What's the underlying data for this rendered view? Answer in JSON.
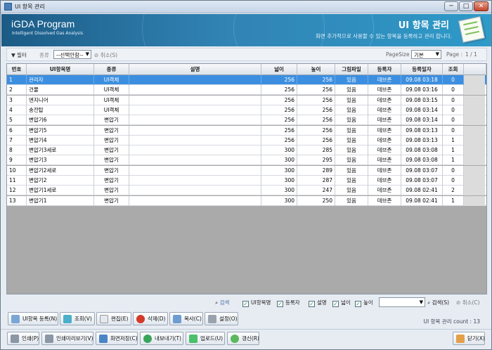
{
  "window": {
    "title": "UI 항목 관리",
    "minimize": "─",
    "maximize": "□",
    "close": "✕"
  },
  "banner": {
    "product": "iGDA Program",
    "subtitle": "Intelligent Dissolved Gas Analysis",
    "heading": "UI 항목 관리",
    "description": "화면 추가적으로 사용할 수 있는 항목을 등록하고 관리 합니다."
  },
  "toolbar": {
    "filter_label": "필터",
    "type_label": "종류",
    "type_value": "--선택안함--",
    "cancel_label": "취소(S)",
    "pagesize_label": "PageSize",
    "pagesize_value": "기본",
    "page_label": "Page :",
    "page_value": "1 / 1"
  },
  "table": {
    "columns": [
      "번호",
      "UI항목명",
      "종류",
      "설명",
      "넓이",
      "높이",
      "그림파일",
      "등록자",
      "등록일자",
      "조회"
    ],
    "rows": [
      [
        "1",
        "관리자",
        "UI객체",
        "",
        "256",
        "256",
        "있음",
        "데브존",
        "09.08 03:18",
        "0"
      ],
      [
        "2",
        "건물",
        "UI객체",
        "",
        "256",
        "256",
        "있음",
        "데브존",
        "09.08 03:16",
        "0"
      ],
      [
        "3",
        "엔지니어",
        "UI객체",
        "",
        "256",
        "256",
        "있음",
        "데브존",
        "09.08 03:15",
        "0"
      ],
      [
        "4",
        "송전탑",
        "UI객체",
        "",
        "256",
        "256",
        "있음",
        "데브존",
        "09.08 03:14",
        "0"
      ],
      [
        "5",
        "변압기6",
        "변압기",
        "",
        "256",
        "256",
        "있음",
        "데브존",
        "09.08 03:14",
        "0"
      ],
      [
        "6",
        "변압기5",
        "변압기",
        "",
        "256",
        "256",
        "있음",
        "데브존",
        "09.08 03:13",
        "0"
      ],
      [
        "7",
        "변압기4",
        "변압기",
        "",
        "256",
        "256",
        "있음",
        "데브존",
        "09.08 03:13",
        "1"
      ],
      [
        "8",
        "변압기3세로",
        "변압기",
        "",
        "300",
        "285",
        "있음",
        "데브존",
        "09.08 03:08",
        "1"
      ],
      [
        "9",
        "변압기3",
        "변압기",
        "",
        "300",
        "295",
        "있음",
        "데브존",
        "09.08 03:08",
        "1"
      ],
      [
        "10",
        "변압기2세로",
        "변압기",
        "",
        "300",
        "289",
        "있음",
        "데브존",
        "09.08 03:07",
        "0"
      ],
      [
        "11",
        "변압기2",
        "변압기",
        "",
        "300",
        "287",
        "있음",
        "데브존",
        "09.08 03:07",
        "0"
      ],
      [
        "12",
        "변압기1세로",
        "변압기",
        "",
        "300",
        "247",
        "있음",
        "데브존",
        "09.08 02:41",
        "2"
      ],
      [
        "13",
        "변압기1",
        "변압기",
        "",
        "300",
        "250",
        "있음",
        "데브존",
        "09.08 02:41",
        "1"
      ]
    ]
  },
  "search": {
    "search_label": "검색",
    "checks": [
      "UI항목명",
      "등록자",
      "설명",
      "넓이",
      "높이"
    ],
    "search_button": "검색(S)",
    "cancel_button": "취소(C)"
  },
  "actions": {
    "register": "UI항목 등록(N)",
    "view": "조회(V)",
    "edit": "편집(E)",
    "delete": "삭제(D)",
    "copy": "복사(C)",
    "settings": "설정(O)",
    "count": "UI 항목 관리 count : 13"
  },
  "bottom": {
    "print": "인쇄(P)",
    "preview": "인쇄미리보기(V)",
    "screen_save": "화면저장(C)",
    "export": "내보내기(T)",
    "upload": "업로드(U)",
    "refresh": "갱신(R)",
    "close": "닫기(X)"
  }
}
